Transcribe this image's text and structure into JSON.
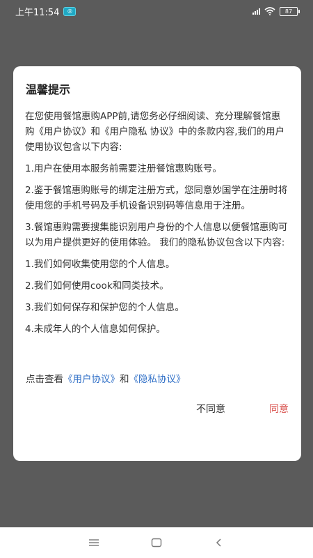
{
  "status_bar": {
    "time": "上午11:54",
    "battery": "87"
  },
  "dialog": {
    "title": "温馨提示",
    "paragraphs": [
      "在您使用餐馆惠购APP前,请您务必仔细阅读、充分理解餐馆惠购《用户协议》和《用户隐私 协议》中的条款内容,我们的用户使用协议包含以下内容:",
      "1.用户在使用本服务前需要注册餐馆惠购账号。",
      "2.鉴于餐馆惠购账号的绑定注册方式，您同意妙国学在注册时将使用您的手机号码及手机设备识别码等信息用于注册。",
      "3.餐馆惠购需要搜集能识别用户身份的个人信息以便餐馆惠购可以为用户提供更好的使用体验。 我们的隐私协议包含以下内容:",
      "1.我们如何收集使用您的个人信息。",
      "2.我们如何使用cook和同类技术。",
      "3.我们如何保存和保护您的个人信息。",
      "4.未成年人的个人信息如何保护。"
    ],
    "agree_prefix": "点击查看",
    "user_agreement_link": "《用户协议》",
    "agree_and": "和",
    "privacy_link": "《隐私协议》",
    "disagree_label": "不同意",
    "agree_label": "同意"
  },
  "colors": {
    "overlay": "#5b5b5b",
    "link": "#2f6fc7",
    "agree": "#d9534f"
  }
}
